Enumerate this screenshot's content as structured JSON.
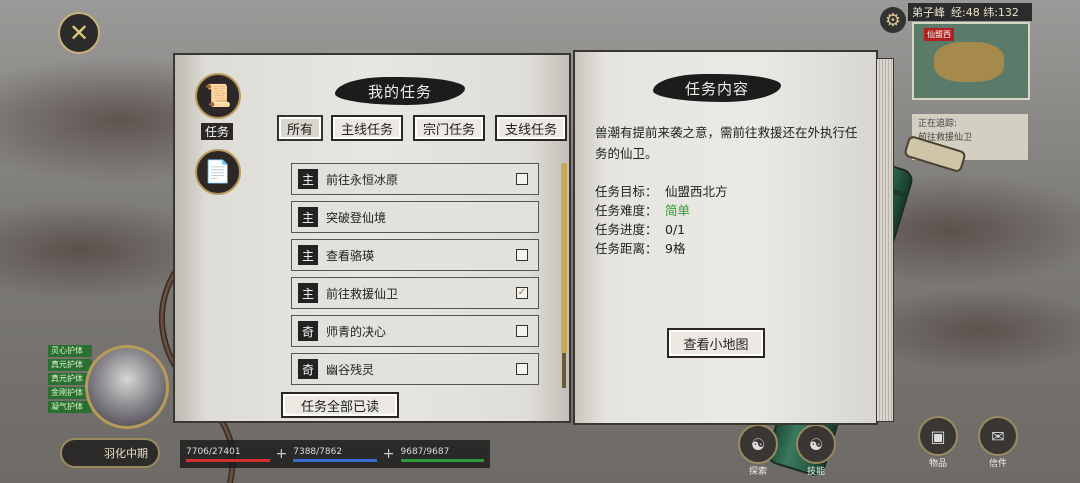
{
  "nav": {
    "close_label": "✕"
  },
  "hud": {
    "top_right": {
      "location": "弟子峰",
      "coords": "经:48 纬:132"
    },
    "minimap_tag": "仙盟西",
    "tracker": {
      "title": "正在追踪:",
      "quest": "前往救援仙卫"
    },
    "buffs": [
      "灵心护体",
      "真元护体",
      "真元护体",
      "金刚护体",
      "凝气护体"
    ],
    "realm": "羽化中期",
    "stats": [
      {
        "value": "7706/27401",
        "color": "#d03030"
      },
      {
        "value": "7388/7862",
        "color": "#3a6ad0"
      },
      {
        "value": "9687/9687",
        "color": "#2a9a3a"
      }
    ],
    "bottom_buttons": [
      {
        "label": "探索",
        "icon": "explore-icon"
      },
      {
        "label": "技能",
        "icon": "skill-icon"
      },
      {
        "label": "物品",
        "icon": "bag-icon"
      },
      {
        "label": "信件",
        "icon": "mail-icon"
      }
    ]
  },
  "quest_book": {
    "title": "我的任务",
    "side_tabs": [
      {
        "label": "任务",
        "icon": "scroll-icon"
      },
      {
        "label": "",
        "icon": "document-icon"
      }
    ],
    "filters": [
      "所有",
      "主线任务",
      "宗门任务",
      "支线任务"
    ],
    "active_filter": 0,
    "quests": [
      {
        "tag": "主",
        "name": "前往永恒冰原",
        "checkbox": true,
        "checked": false
      },
      {
        "tag": "主",
        "name": "突破登仙境",
        "checkbox": false,
        "checked": false
      },
      {
        "tag": "主",
        "name": "查看骆瑛",
        "checkbox": true,
        "checked": false
      },
      {
        "tag": "主",
        "name": "前往救援仙卫",
        "checkbox": true,
        "checked": true
      },
      {
        "tag": "奇",
        "name": "师青的决心",
        "checkbox": true,
        "checked": false
      },
      {
        "tag": "奇",
        "name": "幽谷残灵",
        "checkbox": true,
        "checked": false
      }
    ],
    "mark_all_read": "任务全部已读"
  },
  "quest_detail": {
    "title": "任务内容",
    "description": "兽潮有提前来袭之意，需前往救援还在外执行任务的仙卫。",
    "target_label": "任务目标：",
    "target_value": "仙盟西北方",
    "difficulty_label": "任务难度：",
    "difficulty_value": "简单",
    "progress_label": "任务进度：",
    "progress_value": "0/1",
    "distance_label": "任务距离：",
    "distance_value": "9格",
    "map_button": "查看小地图",
    "difficulty_color": "#2e9c2e"
  }
}
